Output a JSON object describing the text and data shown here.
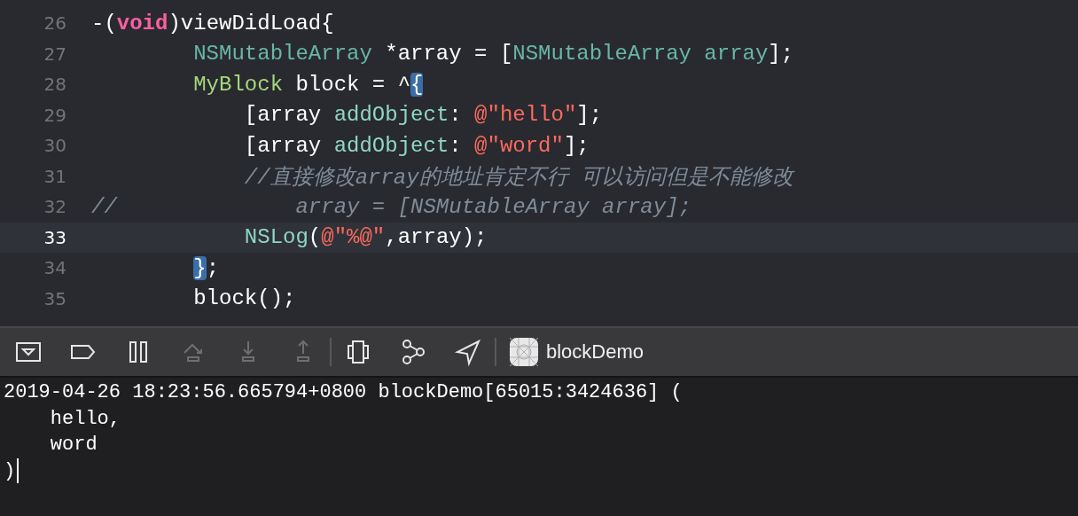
{
  "editor": {
    "lines": [
      {
        "number": "26",
        "current": false,
        "tokens": [
          {
            "kind": "plain",
            "text": "-("
          },
          {
            "kind": "keyword",
            "text": "void"
          },
          {
            "kind": "plain",
            "text": ")viewDidLoad{"
          }
        ]
      },
      {
        "number": "27",
        "current": false,
        "tokens": [
          {
            "kind": "class",
            "text": "        NSMutableArray"
          },
          {
            "kind": "plain",
            "text": " *array = ["
          },
          {
            "kind": "class",
            "text": "NSMutableArray"
          },
          {
            "kind": "class",
            "text": " array"
          },
          {
            "kind": "plain",
            "text": "];"
          }
        ]
      },
      {
        "number": "28",
        "current": false,
        "tokens": [
          {
            "kind": "type",
            "text": "        MyBlock"
          },
          {
            "kind": "plain",
            "text": " block = ^"
          },
          {
            "kind": "match",
            "text": "{"
          }
        ]
      },
      {
        "number": "29",
        "current": false,
        "tokens": [
          {
            "kind": "plain",
            "text": "            [array "
          },
          {
            "kind": "method",
            "text": "addObject"
          },
          {
            "kind": "plain",
            "text": ": "
          },
          {
            "kind": "string",
            "text": "@\"hello\""
          },
          {
            "kind": "plain",
            "text": "];"
          }
        ]
      },
      {
        "number": "30",
        "current": false,
        "tokens": [
          {
            "kind": "plain",
            "text": "            [array "
          },
          {
            "kind": "method",
            "text": "addObject"
          },
          {
            "kind": "plain",
            "text": ": "
          },
          {
            "kind": "string",
            "text": "@\"word\""
          },
          {
            "kind": "plain",
            "text": "];"
          }
        ]
      },
      {
        "number": "31",
        "current": false,
        "tokens": [
          {
            "kind": "comment",
            "text": "            //直接修改array的地址肯定不行 可以访问但是不能修改"
          }
        ]
      },
      {
        "number": "32",
        "current": false,
        "tokens": [
          {
            "kind": "comment",
            "text": "//              array = [NSMutableArray array];"
          }
        ]
      },
      {
        "number": "33",
        "current": true,
        "tokens": [
          {
            "kind": "method",
            "text": "            NSLog"
          },
          {
            "kind": "plain",
            "text": "("
          },
          {
            "kind": "string",
            "text": "@\"%@\""
          },
          {
            "kind": "plain",
            "text": ",array);"
          }
        ]
      },
      {
        "number": "34",
        "current": false,
        "tokens": [
          {
            "kind": "match",
            "text": "        }"
          },
          {
            "kind": "plain",
            "text": ";"
          }
        ]
      },
      {
        "number": "35",
        "current": false,
        "tokens": [
          {
            "kind": "plain",
            "text": "        block();"
          }
        ]
      }
    ]
  },
  "toolbar": {
    "buttons": [
      {
        "kind": "console",
        "disabled": false
      },
      {
        "kind": "breakpoint",
        "disabled": false
      },
      {
        "kind": "pause",
        "disabled": false
      },
      {
        "kind": "step-over",
        "disabled": true
      },
      {
        "kind": "step-in",
        "disabled": true
      },
      {
        "kind": "step-out",
        "disabled": true
      },
      {
        "kind": "divider"
      },
      {
        "kind": "view-debugger",
        "disabled": false
      },
      {
        "kind": "memory-graph",
        "disabled": false
      },
      {
        "kind": "location",
        "disabled": false
      },
      {
        "kind": "divider"
      }
    ],
    "target": "blockDemo"
  },
  "console": {
    "lines": [
      "2019-04-26 18:23:56.665794+0800 blockDemo[65015:3424636] (",
      "    hello,",
      "    word",
      ")"
    ]
  }
}
